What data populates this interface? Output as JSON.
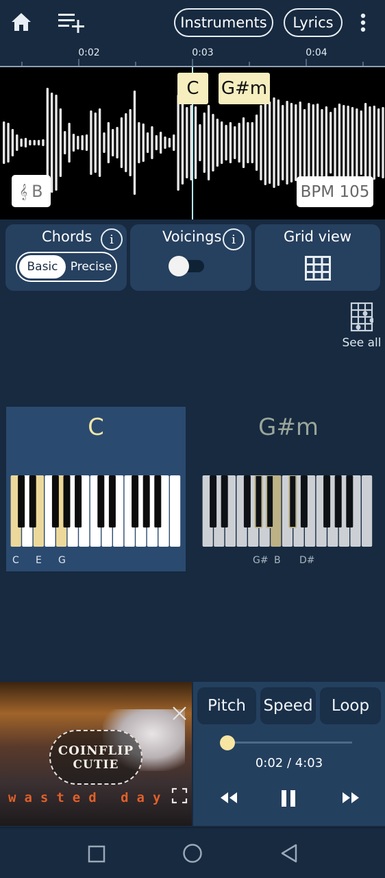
{
  "topbar": {
    "home_icon": "home-icon",
    "add_playlist_icon": "playlist-add-icon",
    "instruments_label": "Instruments",
    "lyrics_label": "Lyrics",
    "more_icon": "more-vert-icon"
  },
  "timeline": {
    "ticks": [
      "0:02",
      "0:03",
      "0:04"
    ]
  },
  "waveform": {
    "chord_current": "C",
    "chord_next": "G#m",
    "key_symbol": "𝄞",
    "key": "B",
    "bpm": "BPM 105"
  },
  "panels": {
    "chords_title": "Chords",
    "basic_label": "Basic",
    "precise_label": "Precise",
    "voicings_title": "Voicings",
    "voicings_enabled": false,
    "grid_title": "Grid view",
    "info_glyph": "i"
  },
  "see_all": {
    "label": "See all",
    "icon": "guitar-chord-grid-icon"
  },
  "chords": [
    {
      "name": "C",
      "notes": [
        "C",
        "E",
        "G"
      ],
      "highlight_white": [
        0,
        2,
        4
      ],
      "highlight_black": []
    },
    {
      "name": "G#m",
      "notes": [
        "G#",
        "B",
        "D#"
      ],
      "highlight_white": [
        6
      ],
      "highlight_black": [
        3,
        4,
        5
      ]
    }
  ],
  "video": {
    "band": "COINFLIP CUTIE",
    "band_line1": "COINFLIP",
    "band_line2": "CUTIE",
    "subtitle": "wasted day"
  },
  "player": {
    "pitch_label": "Pitch",
    "speed_label": "Speed",
    "loop_label": "Loop",
    "time": "0:02 / 4:03",
    "progress": 0.008,
    "playing": true
  },
  "colors": {
    "background": "#172a40",
    "panel": "#26405f",
    "highlight": "#f7eebf",
    "key_highlight": "#ecd89a"
  }
}
